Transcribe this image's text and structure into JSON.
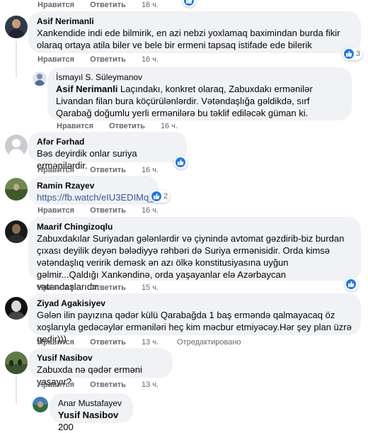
{
  "labels": {
    "like": "Нравится",
    "reply": "Ответить",
    "edited": "Отредактировано"
  },
  "colors": {
    "bubble": "#f0f2f5",
    "meta": "#65676b",
    "like_blue": "#1877f2",
    "link": "#385898"
  },
  "top_partial": {
    "time": "16 ч."
  },
  "comments": [
    {
      "author": "Asif Nerimanli",
      "text": "Xankendide indi ede bilmirik, en azi nebzi yoxlamaq baximindan burda fikir olaraq ortaya atila biler ve bele bir ermeni tapsaq istifade ede bilerik",
      "time": "16 ч.",
      "reactions": "",
      "reply": {
        "author": "İsmayıl S. Süleymanov",
        "tag": "Asif Nerimanli",
        "text": " Laçındakı, konkret olaraq, Zabuxdakı ermənilər Livandan filan bura köçürülənlərdir. Vətəndaşlığa gəldikdə, sırf Qarabağ doğumlu yerli ermənilərə bu təklif ediləcək güman ki.",
        "time": "16 ч."
      }
    },
    {
      "author": "Afər Fərhad",
      "text": "Bəs deyirdik onlar suriya ermənilərdir.",
      "time": "16 ч."
    },
    {
      "author": "Ramin Rzayev",
      "link": "https://fb.watch/eIU3EDIMq_/",
      "time": "16 ч.",
      "reactions": "2"
    },
    {
      "author": "Maarif Chingizoqlu",
      "text": "Zabuxdakılar Suriyadan gələnlərdir və çiynində avtomat gəzdirib-biz burdan çıxası deyilik deyən bələdiyyə rəhbəri də Suriya ermənisidir. Orda kimsə vətəndaşlıq veririk deməsk ən azı ölkə konstitusiyasına uyğun gəlmir...Qaldığı Xankəndinə, orda yaşayanlar elə Azərbaycan vətəndaşlarıdır...",
      "time": "15 ч."
    },
    {
      "author": "Ziyad Agakisiyev",
      "text": "Gələn ilin payızına qədər külü Qarabağda 1 baş erməndə qalmayacaq öz xoşlarıyla gedəcəylər erməniləri heç kim məcbur etmiyəcəy.Hər şey plan üzrə gedir)))",
      "time": "13 ч."
    },
    {
      "author": "Yusif Nasibov",
      "text": "Zabuxda nə qədər erməni yaşayır?",
      "time": "13 ч.",
      "reply": {
        "author": "Anar Mustafayev",
        "tag": "Yusif Nasibov",
        "text": " 200"
      }
    }
  ]
}
